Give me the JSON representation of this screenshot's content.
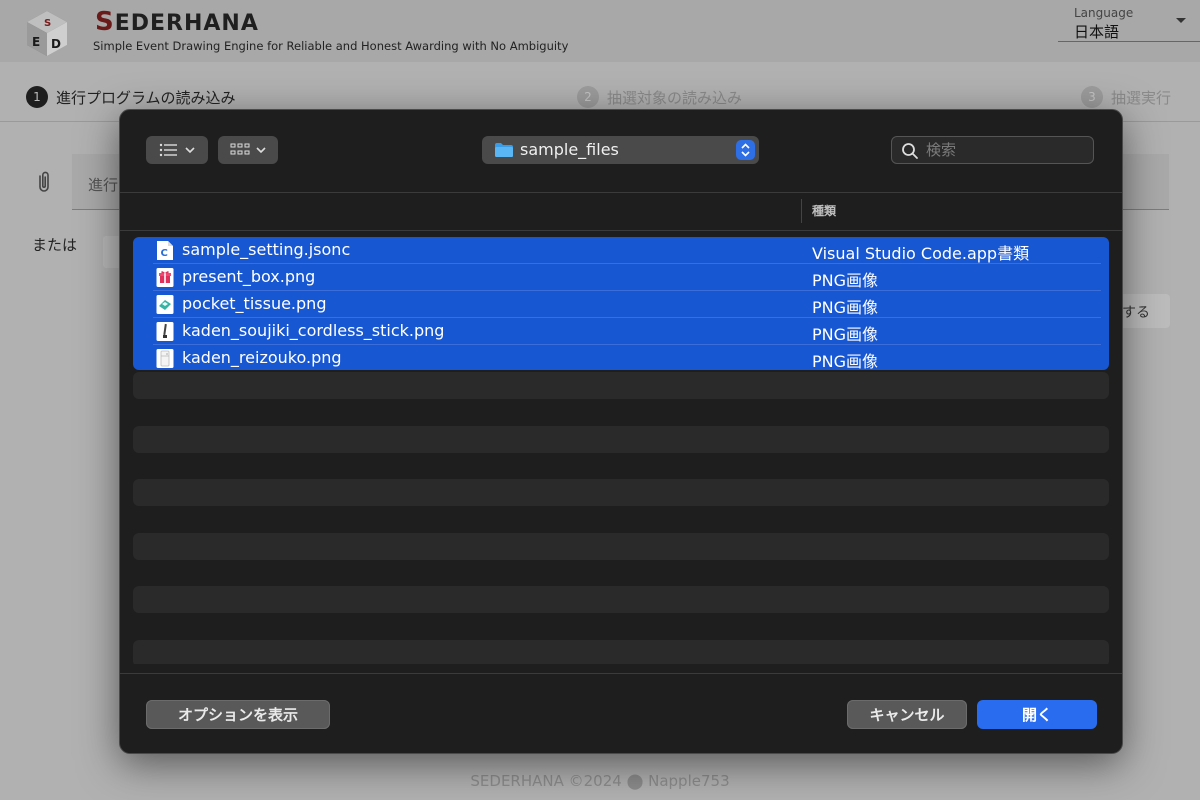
{
  "app": {
    "brand_title_first": "S",
    "brand_title_rest": "EDERHANA",
    "brand_subtitle": "Simple Event Drawing Engine for Reliable and Honest Awarding with No Ambiguity",
    "language_label": "Language",
    "language_value": "日本語",
    "steps": [
      {
        "num": "1",
        "label": "進行プログラムの読み込み"
      },
      {
        "num": "2",
        "label": "抽選対象の読み込み"
      },
      {
        "num": "3",
        "label": "抽選実行"
      }
    ],
    "file_field_text": "進行",
    "or_text": "または",
    "right_button_text": "する",
    "footer": "SEDERHANA ©2024 ⬤ Napple753"
  },
  "dialog": {
    "folder_name": "sample_files",
    "search_placeholder": "検索",
    "column_kind": "種類",
    "files": [
      {
        "name": "sample_setting.jsonc",
        "kind": "Visual Studio Code.app書類",
        "icon": "jsonc-file-icon"
      },
      {
        "name": "present_box.png",
        "kind": "PNG画像",
        "icon": "present-box-image-icon"
      },
      {
        "name": "pocket_tissue.png",
        "kind": "PNG画像",
        "icon": "pocket-tissue-image-icon"
      },
      {
        "name": "kaden_soujiki_cordless_stick.png",
        "kind": "PNG画像",
        "icon": "vacuum-image-icon"
      },
      {
        "name": "kaden_reizouko.png",
        "kind": "PNG画像",
        "icon": "fridge-image-icon"
      }
    ],
    "options_button": "オプションを表示",
    "cancel_button": "キャンセル",
    "open_button": "開く",
    "accent_color": "#1857d2"
  }
}
